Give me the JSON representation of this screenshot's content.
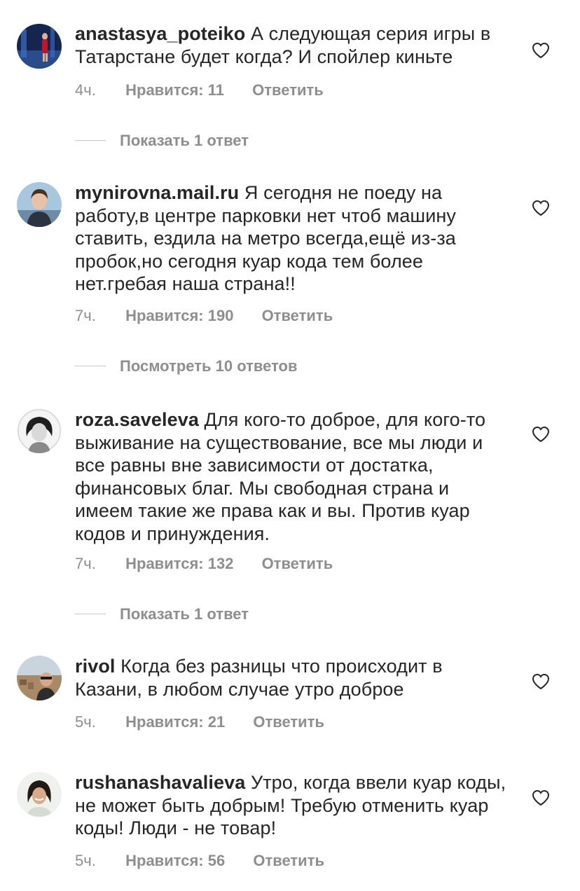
{
  "comments": [
    {
      "username": "anastasya_poteiko",
      "text": "А следующая серия игры в Татарстане будет когда? И спойлер киньте",
      "time": "4ч.",
      "likes": "Нравится: 11",
      "reply": "Ответить",
      "replies_toggle": "Показать 1 ответ",
      "avatar_colors": [
        "#1b2f5e",
        "#c0142a"
      ]
    },
    {
      "username": "mynirovna.mail.ru",
      "text": "Я сегодня не поеду на работу,в центре парковки нет чтоб машину ставить, ездила на метро всегда,ещё из-за пробок,но сегодня куар кода тем более нет.гребая наша страна!!",
      "time": "7ч.",
      "likes": "Нравится: 190",
      "reply": "Ответить",
      "replies_toggle": "Посмотреть 10 ответов",
      "avatar_colors": [
        "#a7c7df",
        "#2b3340"
      ]
    },
    {
      "username": "roza.saveleva",
      "text": "Для кого-то доброе, для кого-то выживание на существование, все мы люди и все равны вне зависимости от достатка, финансовых благ. Мы свободная страна и имеем такие же права как и вы. Против куар кодов и принуждения.",
      "time": "7ч.",
      "likes": "Нравится: 132",
      "reply": "Ответить",
      "replies_toggle": "Показать 1 ответ",
      "avatar_colors": [
        "#f2f2f2",
        "#2a2a2a"
      ]
    },
    {
      "username": "rivol",
      "text": "Когда без разницы что происходит в Казани, в любом случае утро доброе",
      "time": "5ч.",
      "likes": "Нравится: 21",
      "reply": "Ответить",
      "avatar_colors": [
        "#b89b7a",
        "#3a3a3a"
      ]
    },
    {
      "username": "rushanashavalieva",
      "text": "Утро, когда ввели куар коды, не может быть добрым! Требую отменить куар коды! Люди - не товар!",
      "time": "5ч.",
      "likes": "Нравится: 56",
      "reply": "Ответить",
      "avatar_colors": [
        "#e8ece6",
        "#1f1a17"
      ]
    }
  ],
  "icons": {
    "like": "heart-outline-icon"
  },
  "colors": {
    "text": "#262626",
    "secondary": "#8e8e8e",
    "divider": "#c7c7c7"
  }
}
